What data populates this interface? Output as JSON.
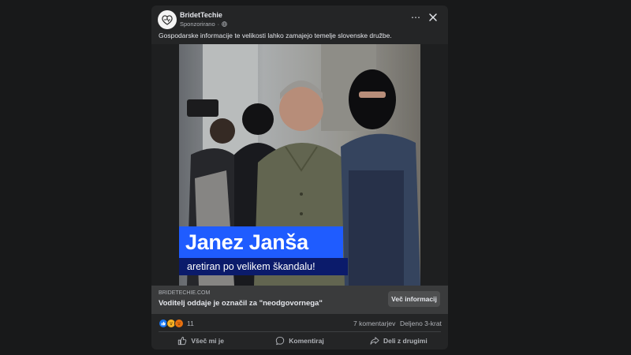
{
  "post": {
    "page_name": "BridetTechie",
    "sponsored_label": "Sponzorirano",
    "more_icon": "⋯",
    "caption": "Gospodarske informacije te velikosti lahko zamajejo temelje slovenske družbe.",
    "image": {
      "headline": "Janez Janša",
      "subheadline": "aretiran po velikem škandalu!",
      "headline_color": "#1f5cff",
      "subheadline_color": "#0b1b6b"
    },
    "link": {
      "domain": "BRIDETECHIE.COM",
      "title": "Voditelj oddaje je označil za \"neodgovornega\"",
      "cta_label": "Več informacij"
    },
    "stats": {
      "reaction_icons": [
        "like-icon",
        "wow-icon",
        "angry-icon"
      ],
      "reaction_count": "11",
      "comments": "7 komentarjev",
      "shares": "Deljeno 3-krat"
    },
    "actions": {
      "like": "Všeč mi je",
      "comment": "Komentiraj",
      "share": "Deli z drugimi"
    }
  }
}
